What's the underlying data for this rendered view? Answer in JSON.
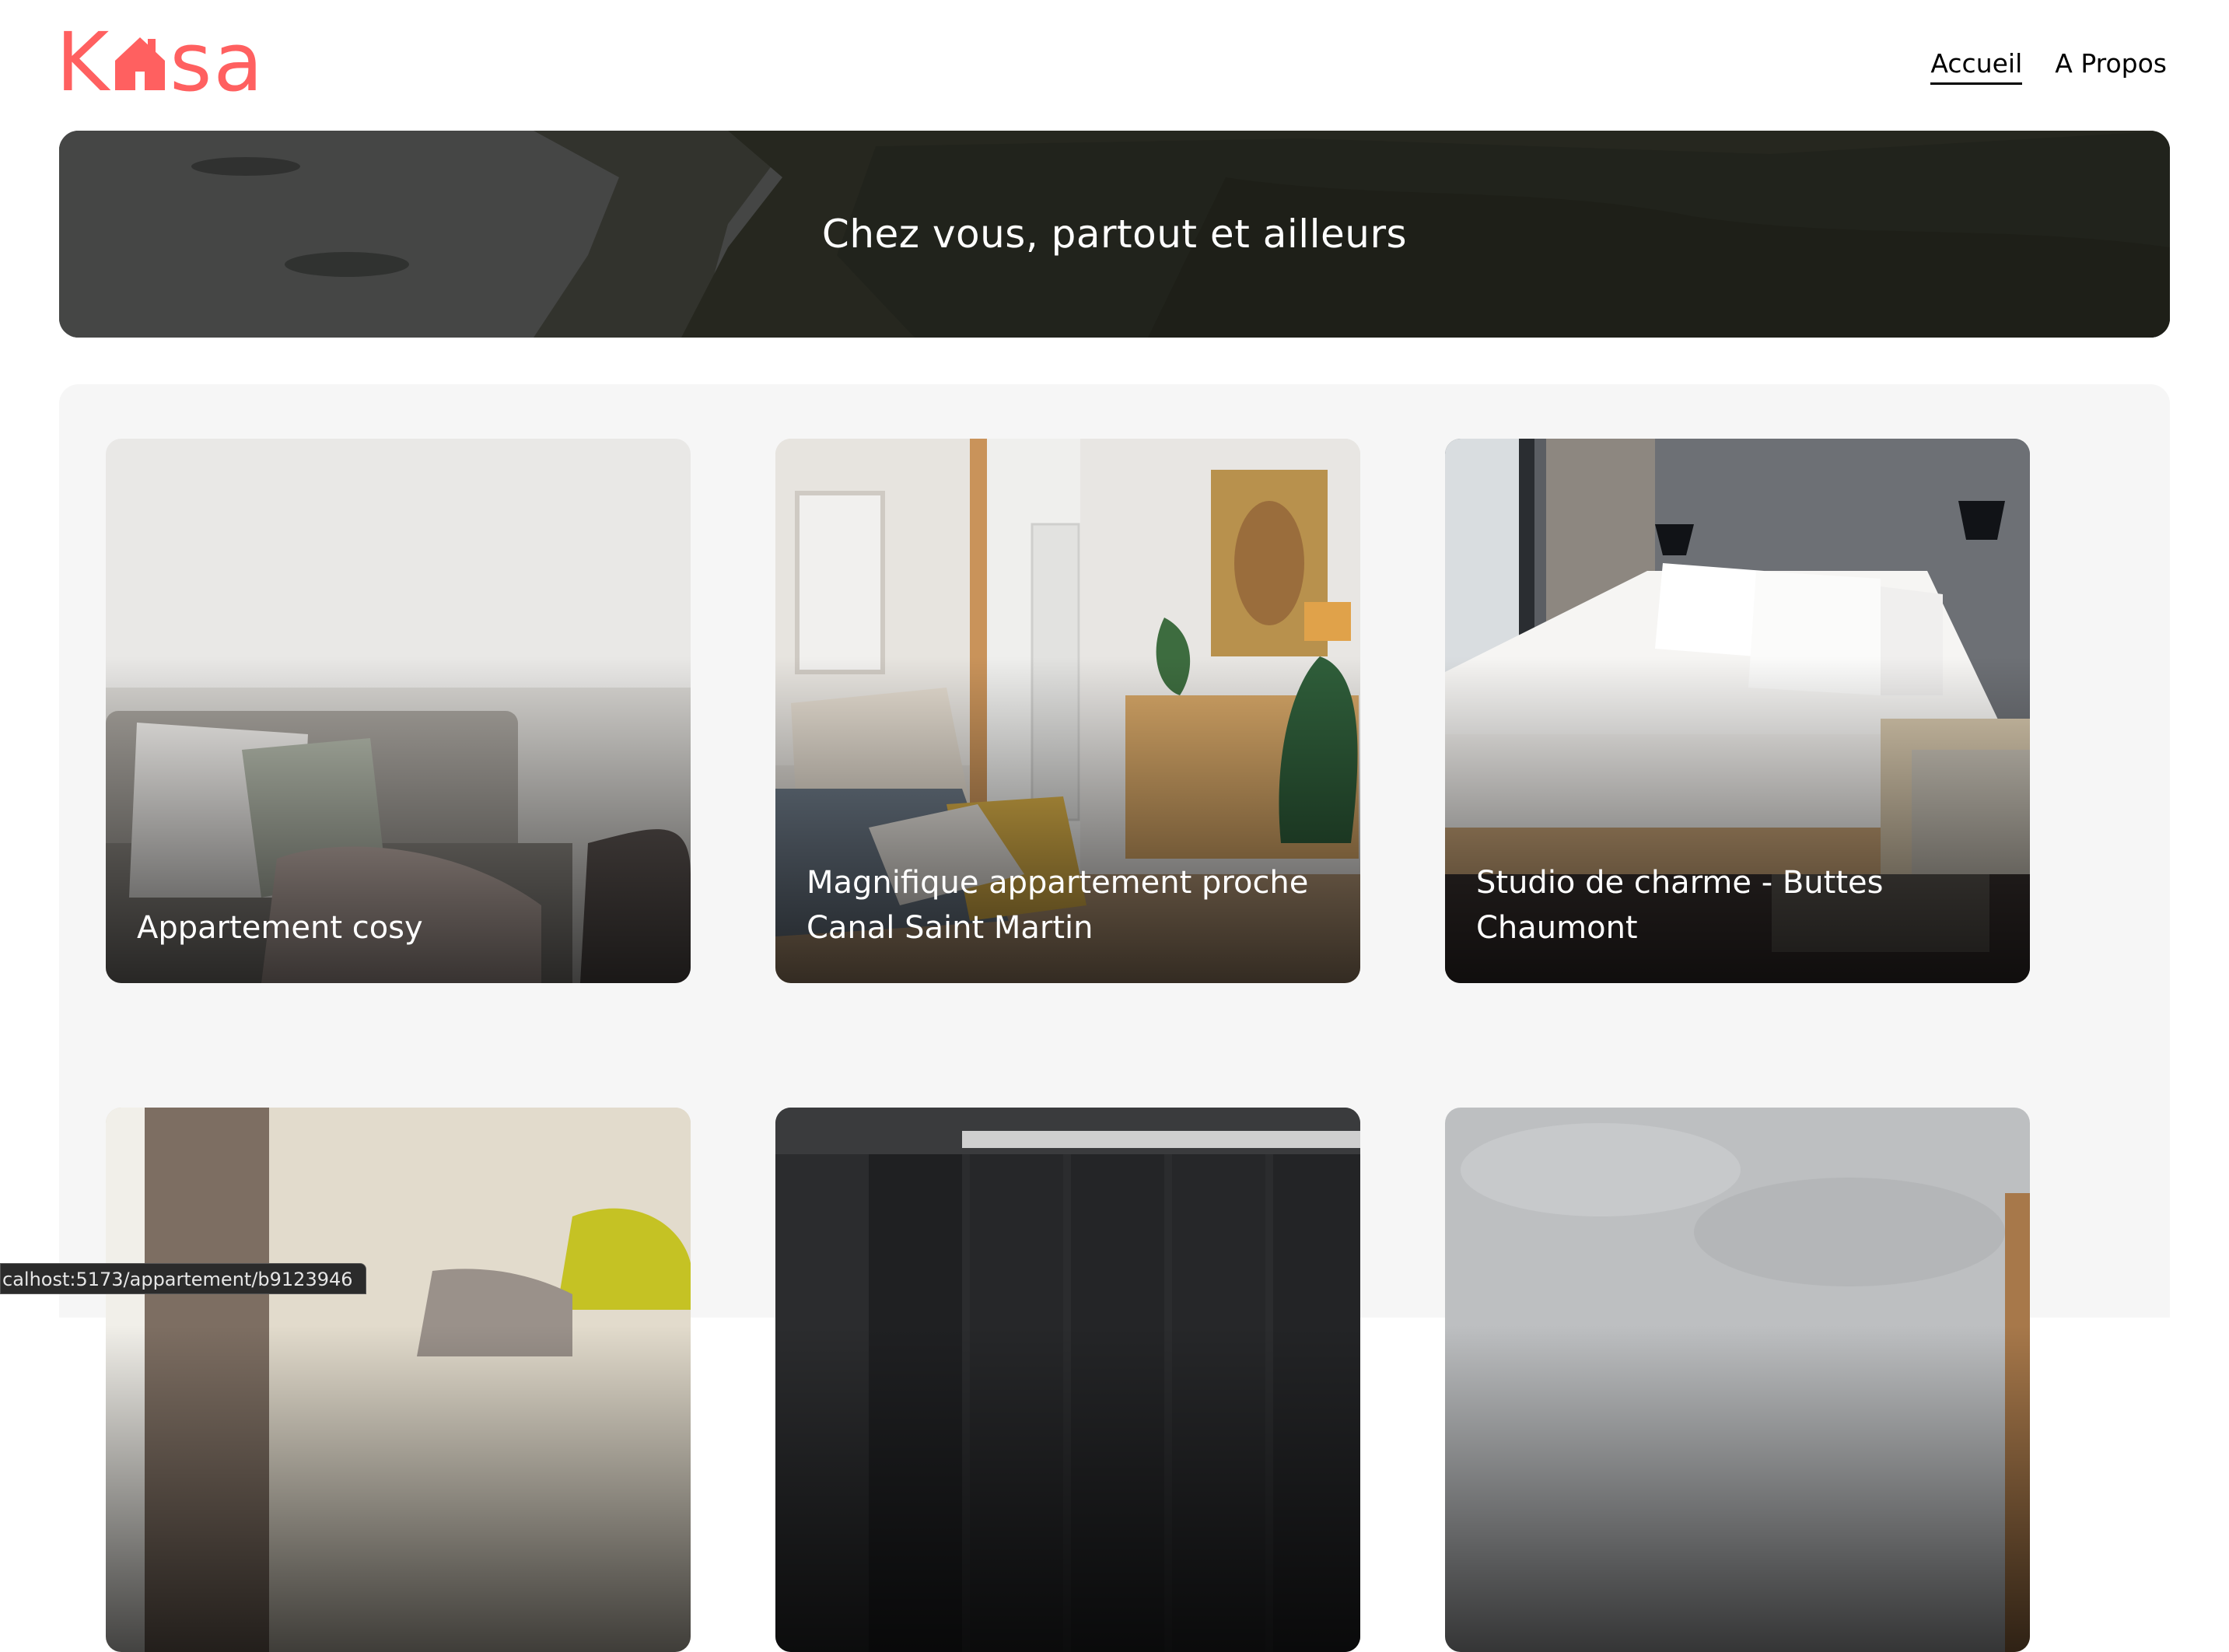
{
  "brand": {
    "logo_text_left": "K",
    "logo_text_right": "sa",
    "accent": "#FF6060"
  },
  "nav": {
    "items": [
      {
        "label": "Accueil",
        "active": true
      },
      {
        "label": "A Propos",
        "active": false
      }
    ]
  },
  "banner": {
    "title": "Chez vous, partout et ailleurs"
  },
  "gallery": {
    "background": "#F6F6F6",
    "cards": [
      {
        "title": "Appartement cosy"
      },
      {
        "title": "Magnifique appartement proche Canal Saint Martin"
      },
      {
        "title": "Studio de charme - Buttes Chaumont"
      },
      {
        "title": ""
      },
      {
        "title": ""
      },
      {
        "title": ""
      }
    ]
  },
  "status_bar": {
    "url": "calhost:5173/appartement/b9123946"
  }
}
